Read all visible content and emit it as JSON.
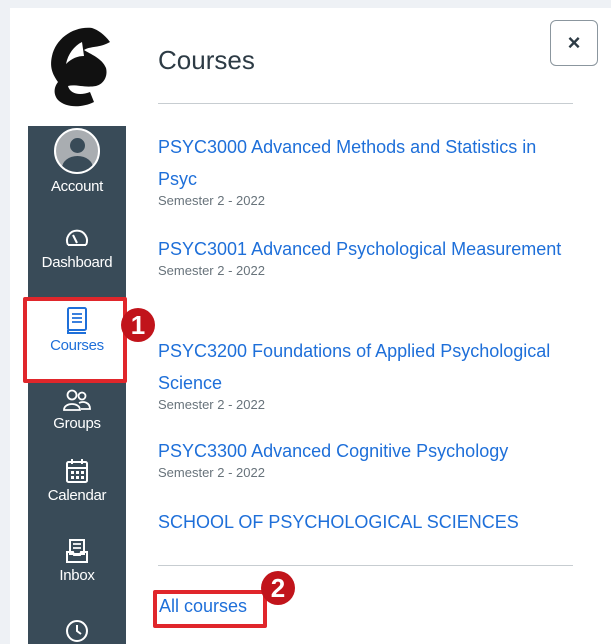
{
  "nav": {
    "logo": "horse-head-logo",
    "items": [
      {
        "label": "Account",
        "icon": "avatar-icon"
      },
      {
        "label": "Dashboard",
        "icon": "dashboard-gauge-icon"
      },
      {
        "label": "Courses",
        "icon": "book-icon"
      },
      {
        "label": "Groups",
        "icon": "groups-icon"
      },
      {
        "label": "Calendar",
        "icon": "calendar-icon"
      },
      {
        "label": "Inbox",
        "icon": "inbox-icon"
      },
      {
        "label": "",
        "icon": "clock-icon"
      }
    ]
  },
  "tray": {
    "title": "Courses",
    "close_label": "×",
    "courses": [
      {
        "name": "PSYC3000 Advanced Methods and Statistics in Psyc",
        "term": "Semester 2 - 2022"
      },
      {
        "name": "PSYC3001 Advanced Psychological Measurement",
        "term": "Semester 2 - 2022"
      },
      {
        "name": "PSYC3200 Foundations of Applied Psychological Science",
        "term": "Semester 2 - 2022"
      },
      {
        "name": "PSYC3300 Advanced Cognitive Psychology",
        "term": "Semester 2 - 2022"
      },
      {
        "name": "SCHOOL OF PSYCHOLOGICAL SCIENCES",
        "term": ""
      }
    ],
    "all_courses_label": "All courses"
  },
  "annotations": {
    "step1": "1",
    "step2": "2",
    "highlight_color": "#e0262b"
  },
  "colors": {
    "nav_bg": "#394b58",
    "link": "#1e6fd9",
    "text": "#2d3b45"
  }
}
